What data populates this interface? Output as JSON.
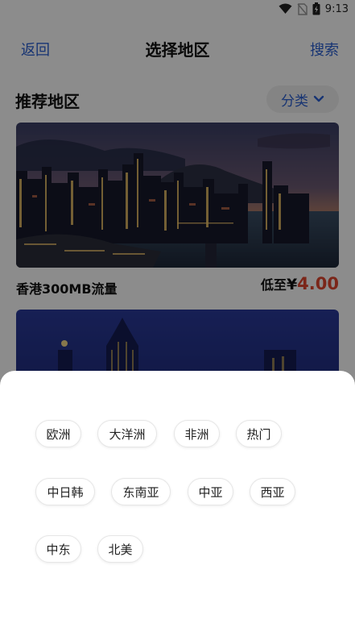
{
  "status_bar": {
    "time": "9:13"
  },
  "nav": {
    "back_label": "返回",
    "title": "选择地区",
    "search_label": "搜索"
  },
  "section": {
    "title": "推荐地区",
    "category_label": "分类"
  },
  "cards": [
    {
      "name": "香港300MB流量",
      "price_prefix": "低至",
      "currency": "¥",
      "price": "4.00"
    },
    {
      "name": "",
      "price_prefix": "",
      "currency": "",
      "price": ""
    }
  ],
  "sheet": {
    "chips": [
      "欧洲",
      "大洋洲",
      "非洲",
      "热门",
      "中日韩",
      "东南亚",
      "中亚",
      "西亚",
      "中东",
      "北美"
    ]
  },
  "colors": {
    "accent": "#2a5fd1",
    "price": "#e0462f"
  }
}
